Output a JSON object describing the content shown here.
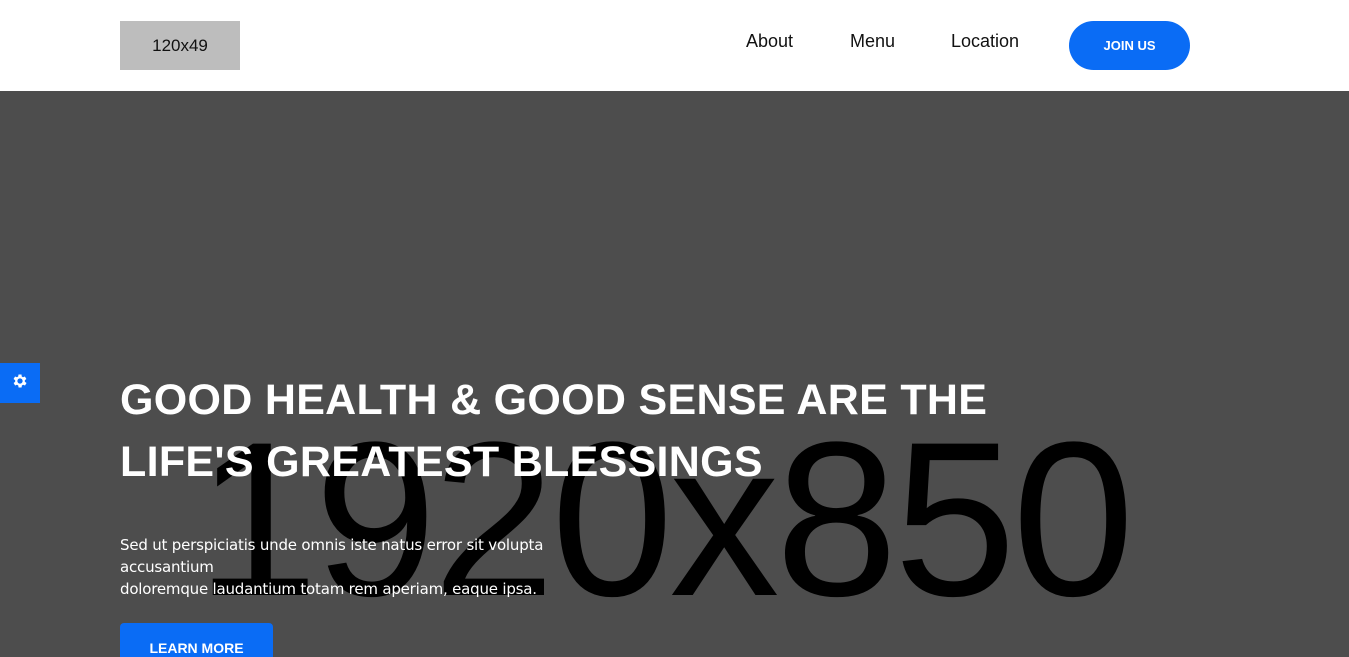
{
  "header": {
    "logo_text": "120x49",
    "nav": {
      "about": "About",
      "menu": "Menu",
      "location": "Location"
    },
    "join_label": "JOIN US"
  },
  "hero": {
    "placeholder_text": "1920x850",
    "title_line1": "GOOD HEALTH & GOOD SENSE ARE THE",
    "title_line2": "LIFE'S GREATEST BLESSINGS",
    "subtitle_line1": "Sed ut perspiciatis unde omnis iste natus error sit volupta accusantium",
    "subtitle_line2": "doloremque laudantium totam rem aperiam, eaque ipsa.",
    "learn_label": "LEARN MORE"
  },
  "settings": {
    "icon": "gear-icon"
  },
  "colors": {
    "accent": "#0a6cf5",
    "hero_bg": "#4d4d4d",
    "logo_bg": "#bdbdbd"
  }
}
